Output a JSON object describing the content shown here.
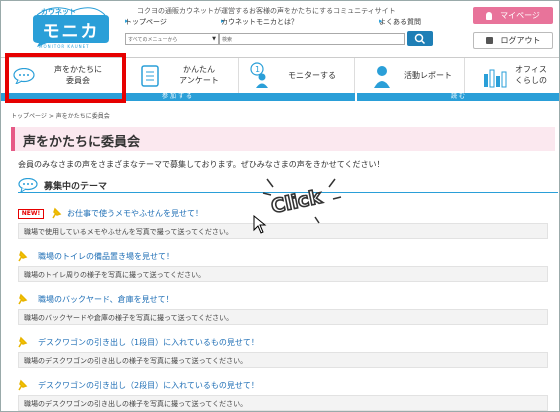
{
  "header": {
    "logo_top": "カウネット",
    "logo_main": "モニカ",
    "logo_sub": "MONITOR KAUNET",
    "tagline": "コクヨの通販カウネットが運営するお客様の声をかたちにするコミュニティサイト",
    "links": [
      "トップページ",
      "カウネットモニカとは？",
      "よくある質問"
    ],
    "menu_select": "すべてのメニューから",
    "search_placeholder": "検索",
    "mypage": "マイページ",
    "logout": "ログアウト"
  },
  "nav": {
    "items": [
      {
        "line1": "声をかたちに",
        "line2": "委員会",
        "icon": "chat-bubble-icon"
      },
      {
        "line1": "かんたん",
        "line2": "アンケート",
        "icon": "clipboard-icon"
      },
      {
        "line1": "モニターする",
        "line2": "",
        "icon": "person-1-icon"
      },
      {
        "line1": "活動レポート",
        "line2": "",
        "icon": "person-icon"
      },
      {
        "line1": "オフィス",
        "line2": "くらしの",
        "icon": "bar-chart-icon"
      }
    ],
    "strips": [
      "参加する",
      "読む"
    ]
  },
  "breadcrumb": [
    "トップページ",
    "声をかたちに委員会"
  ],
  "page_title": "声をかたちに委員会",
  "intro": "会員のみなさまの声をさまざまなテーマで募集しております。ぜひみなさまの声をきかせてください！",
  "section_title": "募集中のテーマ",
  "new_badge": "NEW!",
  "click_text": "Click",
  "themes": [
    {
      "title": "お仕事で使うメモやふせんを見せて！",
      "desc": "職場で使用しているメモやふせんを写真で撮って送ってください。"
    },
    {
      "title": "職場のトイレの備品置き場を見せて！",
      "desc": "職場のトイレ周りの様子を写真に撮って送ってください。"
    },
    {
      "title": "職場のバックヤード、倉庫を見せて！",
      "desc": "職場のバックヤードや倉庫の様子を写真に撮って送ってください。"
    },
    {
      "title": "デスクワゴンの引き出し（1段目）に入れているもの見せて！",
      "desc": "職場のデスクワゴンの引き出しの様子を写真に撮って送ってください。"
    },
    {
      "title": "デスクワゴンの引き出し（2段目）に入れているもの見せて！",
      "desc": "職場のデスクワゴンの引き出しの様子を写真に撮って送ってください。"
    }
  ],
  "colors": {
    "accent": "#2a9fd8",
    "pink": "#e8739a",
    "highlight": "#e60000"
  }
}
